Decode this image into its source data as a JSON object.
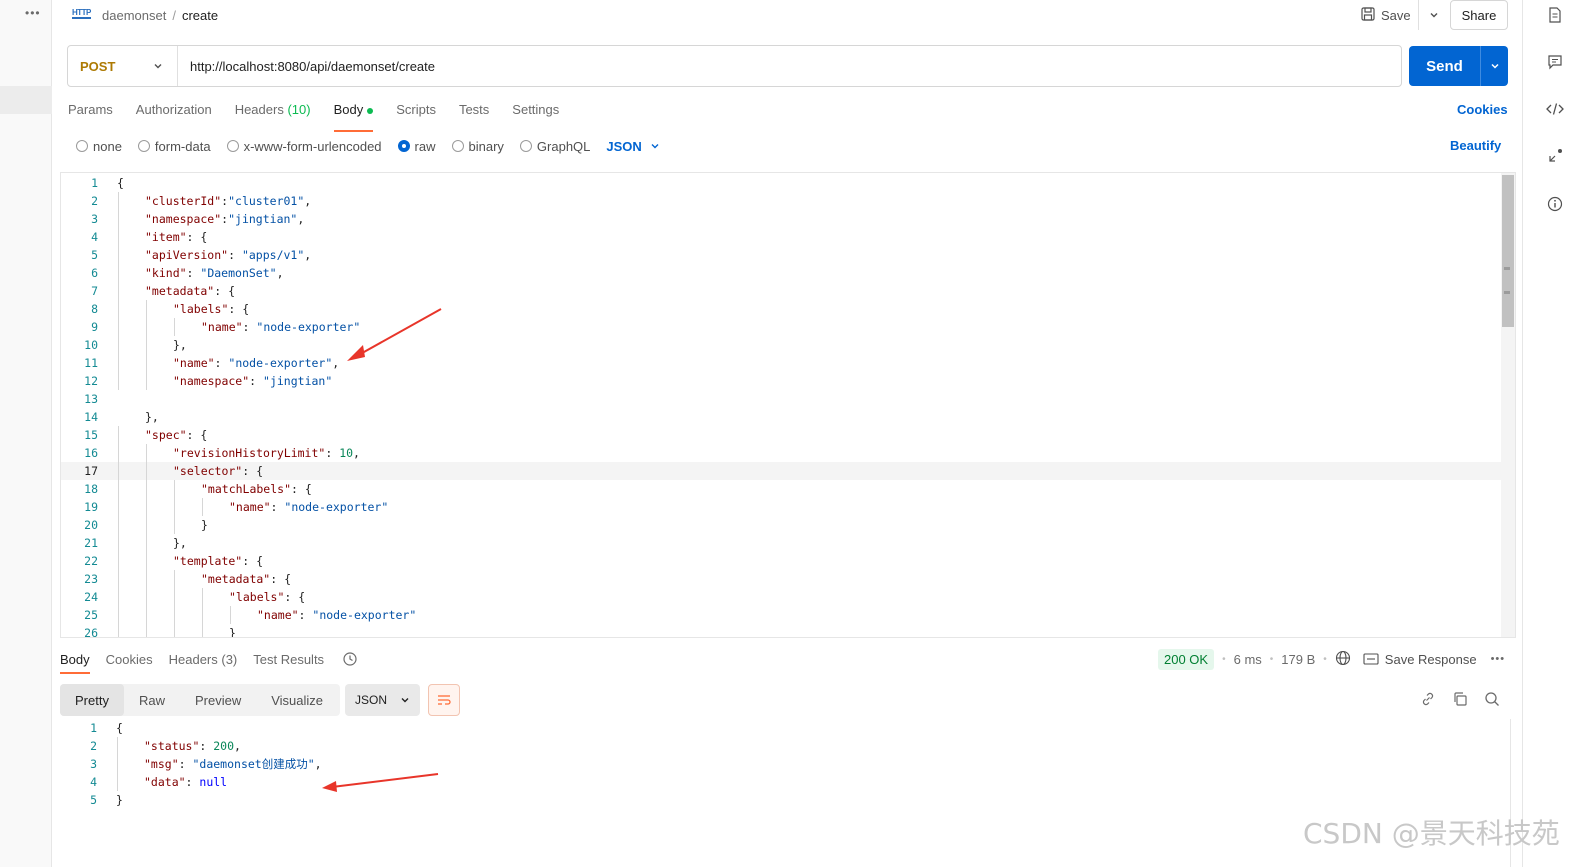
{
  "breadcrumb": {
    "icon_text": "HTTP",
    "parent": "daemonset",
    "separator": "/",
    "current": "create"
  },
  "header": {
    "save_label": "Save",
    "share_label": "Share"
  },
  "request": {
    "method": "POST",
    "url": "http://localhost:8080/api/daemonset/create",
    "send_label": "Send"
  },
  "req_tabs": {
    "params": "Params",
    "authorization": "Authorization",
    "headers": "Headers",
    "headers_count": "(10)",
    "body": "Body",
    "scripts": "Scripts",
    "tests": "Tests",
    "settings": "Settings",
    "cookies": "Cookies"
  },
  "body_types": {
    "none": "none",
    "form_data": "form-data",
    "urlencoded": "x-www-form-urlencoded",
    "raw": "raw",
    "binary": "binary",
    "graphql": "GraphQL",
    "format": "JSON",
    "beautify": "Beautify",
    "selected": "raw"
  },
  "request_body": [
    {
      "ln": "1",
      "indent": 0,
      "tokens": [
        [
          "p",
          "{"
        ]
      ]
    },
    {
      "ln": "2",
      "indent": 1,
      "tokens": [
        [
          "k",
          "\"clusterId\""
        ],
        [
          "p",
          ":"
        ],
        [
          "s",
          "\"cluster01\""
        ],
        [
          "p",
          ","
        ]
      ]
    },
    {
      "ln": "3",
      "indent": 1,
      "tokens": [
        [
          "k",
          "\"namespace\""
        ],
        [
          "p",
          ":"
        ],
        [
          "s",
          "\"jingtian\""
        ],
        [
          "p",
          ","
        ]
      ]
    },
    {
      "ln": "4",
      "indent": 1,
      "tokens": [
        [
          "k",
          "\"item\""
        ],
        [
          "p",
          ": {"
        ]
      ]
    },
    {
      "ln": "5",
      "indent": 1,
      "tokens": [
        [
          "k",
          "\"apiVersion\""
        ],
        [
          "p",
          ": "
        ],
        [
          "s",
          "\"apps/v1\""
        ],
        [
          "p",
          ","
        ]
      ]
    },
    {
      "ln": "6",
      "indent": 1,
      "tokens": [
        [
          "k",
          "\"kind\""
        ],
        [
          "p",
          ": "
        ],
        [
          "s",
          "\"DaemonSet\""
        ],
        [
          "p",
          ","
        ]
      ]
    },
    {
      "ln": "7",
      "indent": 1,
      "tokens": [
        [
          "k",
          "\"metadata\""
        ],
        [
          "p",
          ": {"
        ]
      ]
    },
    {
      "ln": "8",
      "indent": 2,
      "tokens": [
        [
          "k",
          "\"labels\""
        ],
        [
          "p",
          ": {"
        ]
      ]
    },
    {
      "ln": "9",
      "indent": 3,
      "tokens": [
        [
          "k",
          "\"name\""
        ],
        [
          "p",
          ": "
        ],
        [
          "s",
          "\"node-exporter\""
        ]
      ]
    },
    {
      "ln": "10",
      "indent": 2,
      "tokens": [
        [
          "p",
          "},"
        ]
      ]
    },
    {
      "ln": "11",
      "indent": 2,
      "tokens": [
        [
          "k",
          "\"name\""
        ],
        [
          "p",
          ": "
        ],
        [
          "s",
          "\"node-exporter\""
        ],
        [
          "p",
          ","
        ]
      ]
    },
    {
      "ln": "12",
      "indent": 2,
      "tokens": [
        [
          "k",
          "\"namespace\""
        ],
        [
          "p",
          ": "
        ],
        [
          "s",
          "\"jingtian\""
        ]
      ]
    },
    {
      "ln": "13",
      "indent": 0,
      "tokens": []
    },
    {
      "ln": "14",
      "indent": 1,
      "tokens": [
        [
          "p",
          "},"
        ]
      ]
    },
    {
      "ln": "15",
      "indent": 1,
      "tokens": [
        [
          "k",
          "\"spec\""
        ],
        [
          "p",
          ": {"
        ]
      ]
    },
    {
      "ln": "16",
      "indent": 2,
      "tokens": [
        [
          "k",
          "\"revisionHistoryLimit\""
        ],
        [
          "p",
          ": "
        ],
        [
          "n",
          "10"
        ],
        [
          "p",
          ","
        ]
      ]
    },
    {
      "ln": "17",
      "indent": 2,
      "tokens": [
        [
          "k",
          "\"selector\""
        ],
        [
          "p",
          ": {"
        ]
      ]
    },
    {
      "ln": "18",
      "indent": 3,
      "tokens": [
        [
          "k",
          "\"matchLabels\""
        ],
        [
          "p",
          ": {"
        ]
      ]
    },
    {
      "ln": "19",
      "indent": 4,
      "tokens": [
        [
          "k",
          "\"name\""
        ],
        [
          "p",
          ": "
        ],
        [
          "s",
          "\"node-exporter\""
        ]
      ]
    },
    {
      "ln": "20",
      "indent": 3,
      "tokens": [
        [
          "p",
          "}"
        ]
      ]
    },
    {
      "ln": "21",
      "indent": 2,
      "tokens": [
        [
          "p",
          "},"
        ]
      ]
    },
    {
      "ln": "22",
      "indent": 2,
      "tokens": [
        [
          "k",
          "\"template\""
        ],
        [
          "p",
          ": {"
        ]
      ]
    },
    {
      "ln": "23",
      "indent": 3,
      "tokens": [
        [
          "k",
          "\"metadata\""
        ],
        [
          "p",
          ": {"
        ]
      ]
    },
    {
      "ln": "24",
      "indent": 4,
      "tokens": [
        [
          "k",
          "\"labels\""
        ],
        [
          "p",
          ": {"
        ]
      ]
    },
    {
      "ln": "25",
      "indent": 5,
      "tokens": [
        [
          "k",
          "\"name\""
        ],
        [
          "p",
          ": "
        ],
        [
          "s",
          "\"node-exporter\""
        ]
      ]
    },
    {
      "ln": "26",
      "indent": 4,
      "tokens": [
        [
          "p",
          "}"
        ]
      ]
    }
  ],
  "current_line": "17",
  "response": {
    "tabs": {
      "body": "Body",
      "cookies": "Cookies",
      "headers": "Headers (3)",
      "test_results": "Test Results"
    },
    "status": "200 OK",
    "time": "6 ms",
    "size": "179 B",
    "save_response": "Save Response",
    "view_tabs": {
      "pretty": "Pretty",
      "raw": "Raw",
      "preview": "Preview",
      "visualize": "Visualize"
    },
    "format": "JSON",
    "lines": [
      {
        "ln": "1",
        "indent": 0,
        "tokens": [
          [
            "p",
            "{"
          ]
        ]
      },
      {
        "ln": "2",
        "indent": 1,
        "tokens": [
          [
            "k",
            "\"status\""
          ],
          [
            "p",
            ": "
          ],
          [
            "n",
            "200"
          ],
          [
            "p",
            ","
          ]
        ]
      },
      {
        "ln": "3",
        "indent": 1,
        "tokens": [
          [
            "k",
            "\"msg\""
          ],
          [
            "p",
            ": "
          ],
          [
            "s",
            "\"daemonset创建成功\""
          ],
          [
            "p",
            ","
          ]
        ]
      },
      {
        "ln": "4",
        "indent": 1,
        "tokens": [
          [
            "k",
            "\"data\""
          ],
          [
            "p",
            ": "
          ],
          [
            "kw",
            "null"
          ]
        ]
      },
      {
        "ln": "5",
        "indent": 0,
        "tokens": [
          [
            "p",
            "}"
          ]
        ]
      }
    ]
  },
  "watermark": "CSDN @景天科技苑",
  "colors": {
    "accent": "#0265d2",
    "tab_underline": "#ff6c37",
    "method": "#ad7a03",
    "status_ok": "#007f31",
    "arrow": "#e8352a"
  },
  "icons": [
    "http-icon",
    "save-icon",
    "chevron-down-icon",
    "document-icon",
    "comment-icon",
    "code-icon",
    "sparkle-icon",
    "info-icon",
    "history-icon",
    "globe-icon",
    "save-response-icon",
    "more-icon",
    "wrap-icon",
    "link-icon",
    "copy-icon",
    "search-icon"
  ]
}
